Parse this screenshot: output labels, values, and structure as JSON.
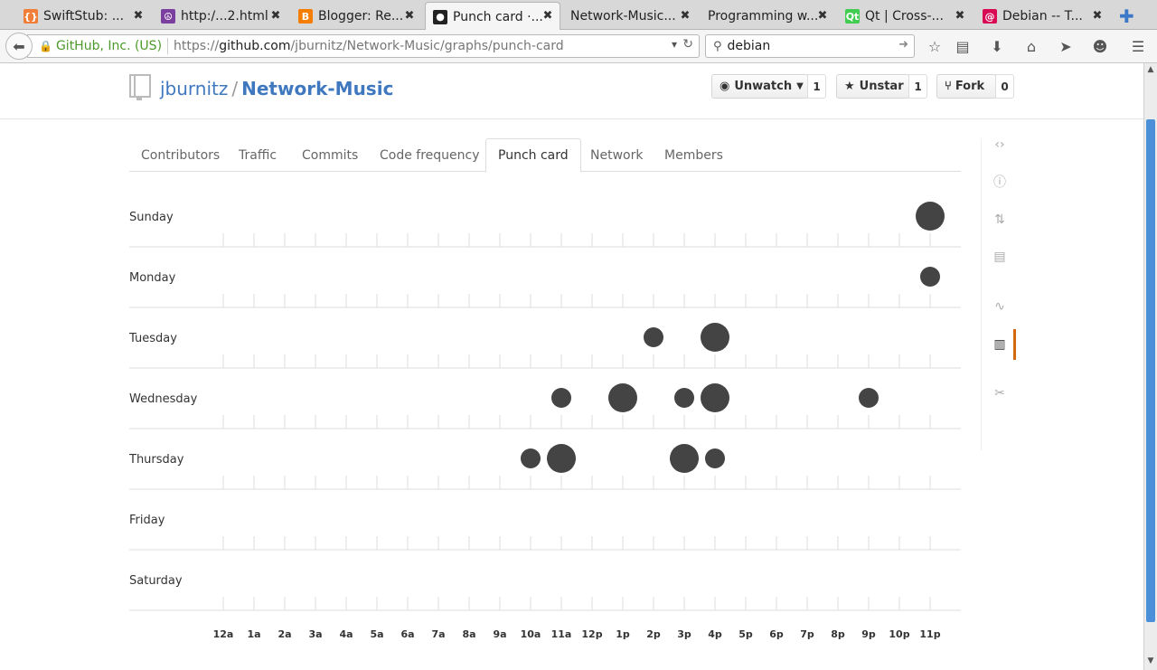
{
  "browser": {
    "tabs": [
      {
        "title": "SwiftStub: ...",
        "favicon": "swiftstub-icon",
        "color": "#f07d38",
        "glyph": "{}"
      },
      {
        "title": "http:/...2.html",
        "favicon": "peace-icon",
        "color": "#7b3fa0",
        "glyph": "☮"
      },
      {
        "title": "Blogger: Re...",
        "favicon": "blogger-icon",
        "color": "#f57d00",
        "glyph": "B"
      },
      {
        "title": "Punch card ·...",
        "favicon": "github-icon",
        "color": "#222222",
        "glyph": "●"
      },
      {
        "title": "Network-Music...",
        "favicon": "",
        "color": "",
        "glyph": ""
      },
      {
        "title": "Programming w...",
        "favicon": "",
        "color": "",
        "glyph": ""
      },
      {
        "title": "Qt | Cross-...",
        "favicon": "qt-icon",
        "color": "#41cd52",
        "glyph": "Qt"
      },
      {
        "title": "Debian -- T...",
        "favicon": "debian-icon",
        "color": "#d70a53",
        "glyph": "@"
      }
    ],
    "active_tab": 3,
    "identity": "GitHub, Inc. (US)",
    "url_prefix": "https://",
    "url_domain": "github.com",
    "url_path": "/jburnitz/Network-Music/graphs/punch-card",
    "search_value": "debian"
  },
  "repo": {
    "owner": "jburnitz",
    "slash": "/",
    "name": "Network-Music",
    "watch_label": "Unwatch",
    "watch_count": "1",
    "star_label": "Unstar",
    "star_count": "1",
    "fork_label": "Fork",
    "fork_count": "0"
  },
  "subtabs": [
    "Contributors",
    "Traffic",
    "Commits",
    "Code frequency",
    "Punch card",
    "Network",
    "Members"
  ],
  "selected_subtab": "Punch card",
  "sidenav_icons": [
    "code-icon",
    "issues-icon",
    "pull-request-icon",
    "wiki-icon",
    "pulse-icon",
    "graphs-icon",
    "settings-icon"
  ],
  "sidenav_current": "graphs-icon",
  "chart_data": {
    "type": "scatter",
    "days": [
      "Sunday",
      "Monday",
      "Tuesday",
      "Wednesday",
      "Thursday",
      "Friday",
      "Saturday"
    ],
    "hours": [
      "12a",
      "1a",
      "2a",
      "3a",
      "4a",
      "5a",
      "6a",
      "7a",
      "8a",
      "9a",
      "10a",
      "11a",
      "12p",
      "1p",
      "2p",
      "3p",
      "4p",
      "5p",
      "6p",
      "7p",
      "8p",
      "9p",
      "10p",
      "11p"
    ],
    "points": [
      {
        "day": "Sunday",
        "hour": "11p",
        "size": 3
      },
      {
        "day": "Monday",
        "hour": "11p",
        "size": 2
      },
      {
        "day": "Tuesday",
        "hour": "2p",
        "size": 2
      },
      {
        "day": "Tuesday",
        "hour": "4p",
        "size": 3
      },
      {
        "day": "Wednesday",
        "hour": "11a",
        "size": 2
      },
      {
        "day": "Wednesday",
        "hour": "1p",
        "size": 3
      },
      {
        "day": "Wednesday",
        "hour": "3p",
        "size": 2
      },
      {
        "day": "Wednesday",
        "hour": "4p",
        "size": 3
      },
      {
        "day": "Wednesday",
        "hour": "9p",
        "size": 2
      },
      {
        "day": "Thursday",
        "hour": "10a",
        "size": 2
      },
      {
        "day": "Thursday",
        "hour": "11a",
        "size": 3
      },
      {
        "day": "Thursday",
        "hour": "3p",
        "size": 3
      },
      {
        "day": "Thursday",
        "hour": "4p",
        "size": 2
      }
    ],
    "dot_color": "#444444",
    "line_color": "#dddddd"
  }
}
